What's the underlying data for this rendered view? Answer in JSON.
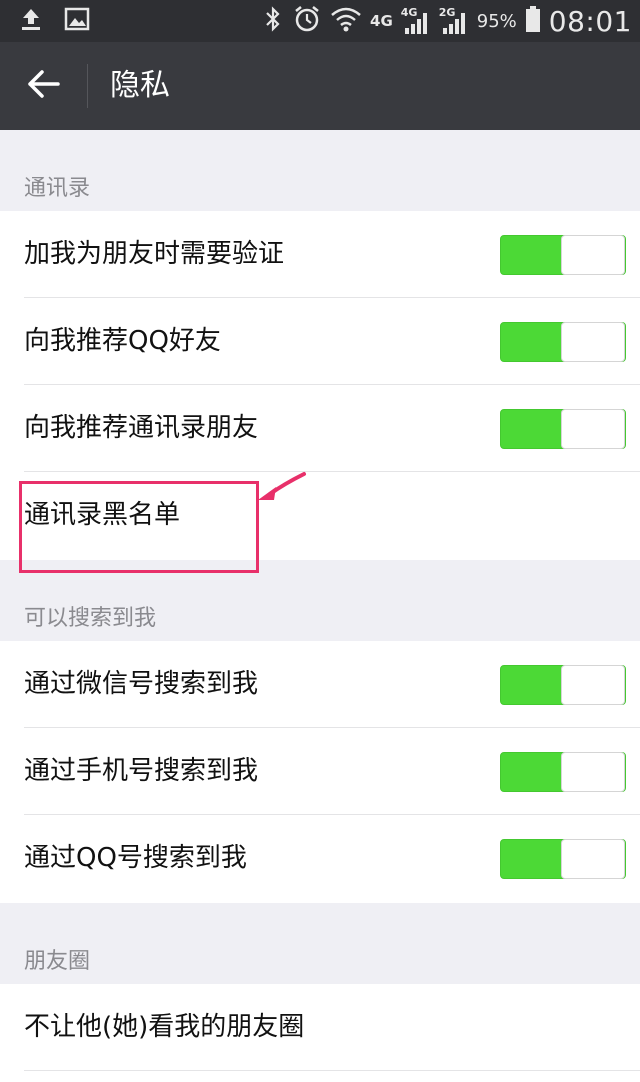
{
  "status_bar": {
    "network_4g": "4G",
    "sim1_label": "4G",
    "sim2_label": "2G",
    "battery": "95%",
    "time": "08:01",
    "icons": [
      "upload-icon",
      "image-icon",
      "bluetooth-icon",
      "alarm-icon",
      "wifi-icon",
      "signal-icon",
      "battery-icon"
    ]
  },
  "header": {
    "title": "隐私",
    "back_icon": "back-arrow-icon"
  },
  "sections": {
    "contacts": {
      "title": "通讯录",
      "items": [
        {
          "label": "加我为朋友时需要验证",
          "toggle": true
        },
        {
          "label": "向我推荐QQ好友",
          "toggle": true
        },
        {
          "label": "向我推荐通讯录朋友",
          "toggle": true
        },
        {
          "label": "通讯录黑名单"
        }
      ]
    },
    "search": {
      "title": "可以搜索到我",
      "items": [
        {
          "label": "通过微信号搜索到我",
          "toggle": true
        },
        {
          "label": "通过手机号搜索到我",
          "toggle": true
        },
        {
          "label": "通过QQ号搜索到我",
          "toggle": true
        }
      ]
    },
    "moments": {
      "title": "朋友圈",
      "items": [
        {
          "label": "不让他(她)看我的朋友圈"
        }
      ]
    }
  },
  "colors": {
    "toggle_on": "#4cd936",
    "title_bar": "#393a3f",
    "highlight": "#e8306a"
  }
}
